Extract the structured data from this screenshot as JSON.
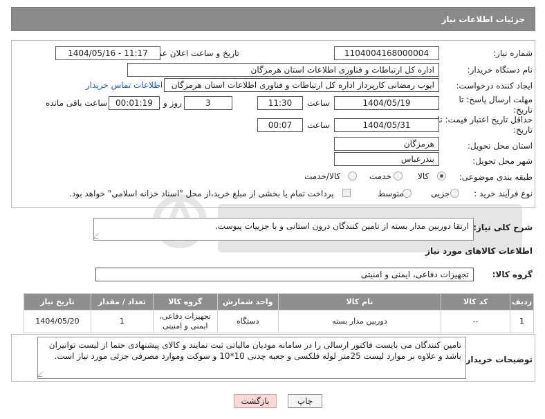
{
  "header": {
    "title": "جزئیات اطلاعات نیاز"
  },
  "fields": {
    "need_number_label": "شماره نیاز:",
    "need_number": "1104004168000004",
    "announce_label": "تاریخ و ساعت اعلان عمومی:",
    "announce_value": "1404/05/16 - 11:17",
    "buyer_org_label": "نام دستگاه خریدار:",
    "buyer_org": "اداره کل ارتباطات و فناوری اطلاعات استان هرمزگان",
    "creator_label": "ایجاد کننده درخواست:",
    "creator": "ایوب رمضانی کارپرداز اداره کل ارتباطات و فناوری اطلاعات استان هرمزگان",
    "contact_link": "اطلاعات تماس خریدار",
    "deadline_label": "مهلت ارسال پاسخ: تا تاریخ:",
    "deadline_date": "1404/05/19",
    "time_label": "ساعت",
    "deadline_time": "11:30",
    "days_value": "3",
    "days_label": "روز و",
    "remaining_time": "00:01:19",
    "remaining_label": "ساعت باقی مانده",
    "validity_label": "حداقل تاریخ اعتبار قیمت: تا تاریخ:",
    "validity_date": "1404/05/31",
    "validity_time": "00:07",
    "province_label": "استان محل تحویل:",
    "province": "هرمزگان",
    "city_label": "شهر محل تحویل:",
    "city": "بندرعباس",
    "category_label": "طبقه بندی موضوعی:",
    "category_options": [
      "کالا",
      "خدمت",
      "کالا/خدمت"
    ],
    "process_label": "نوع فرآیند خرید :",
    "process_options": [
      "جزیی",
      "متوسط"
    ],
    "payment_note": "پرداخت تمام یا بخشی از مبلغ خرید،از محل \"اسناد خزانه اسلامی\" خواهد بود."
  },
  "description": {
    "label": "شرح کلی نیاز:",
    "text": "ارتقا دوربین مدار بسته از تامین کنندگان درون استانی و با جزییات پیوست."
  },
  "goods_section": {
    "title": "اطلاعات کالاهای مورد نیاز",
    "group_label": "گروه کالا:",
    "group_value": "تجهیزات دفاعی، ایمنی و امنیتی"
  },
  "table": {
    "headers": [
      "ردیف",
      "کد کالا",
      "نام کالا",
      "واحد شمارش",
      "گروه کالا",
      "تعداد / مقدار",
      "تاریخ نیاز"
    ],
    "rows": [
      [
        "1",
        "--",
        "دوربین مدار بسته",
        "دستگاه",
        "تجهیزات دفاعی، ایمنی و امنیتی",
        "1",
        "1404/05/20"
      ]
    ]
  },
  "buyer_notes": {
    "label": "توضیحات خریدار:",
    "text": "تامین کنندگان می بایست فاکتور ارسالی را در سامانه مودیان مالیاتی ثبت نمایند و کالای پیشنهادی حتما از لیست توانیران باشد و علاوه بر موارد لیست 25متر لوله فلکسی و جعبه چدنی 10*10 و سوکت وموارد مصرفی جزئی مورد نیاز است."
  },
  "buttons": {
    "print": "چاپ",
    "back": "بازگشت"
  },
  "colors": {
    "header_bg": "#8a8a8a",
    "link": "#1a5bbf",
    "back_button": "#fbd8d8"
  }
}
